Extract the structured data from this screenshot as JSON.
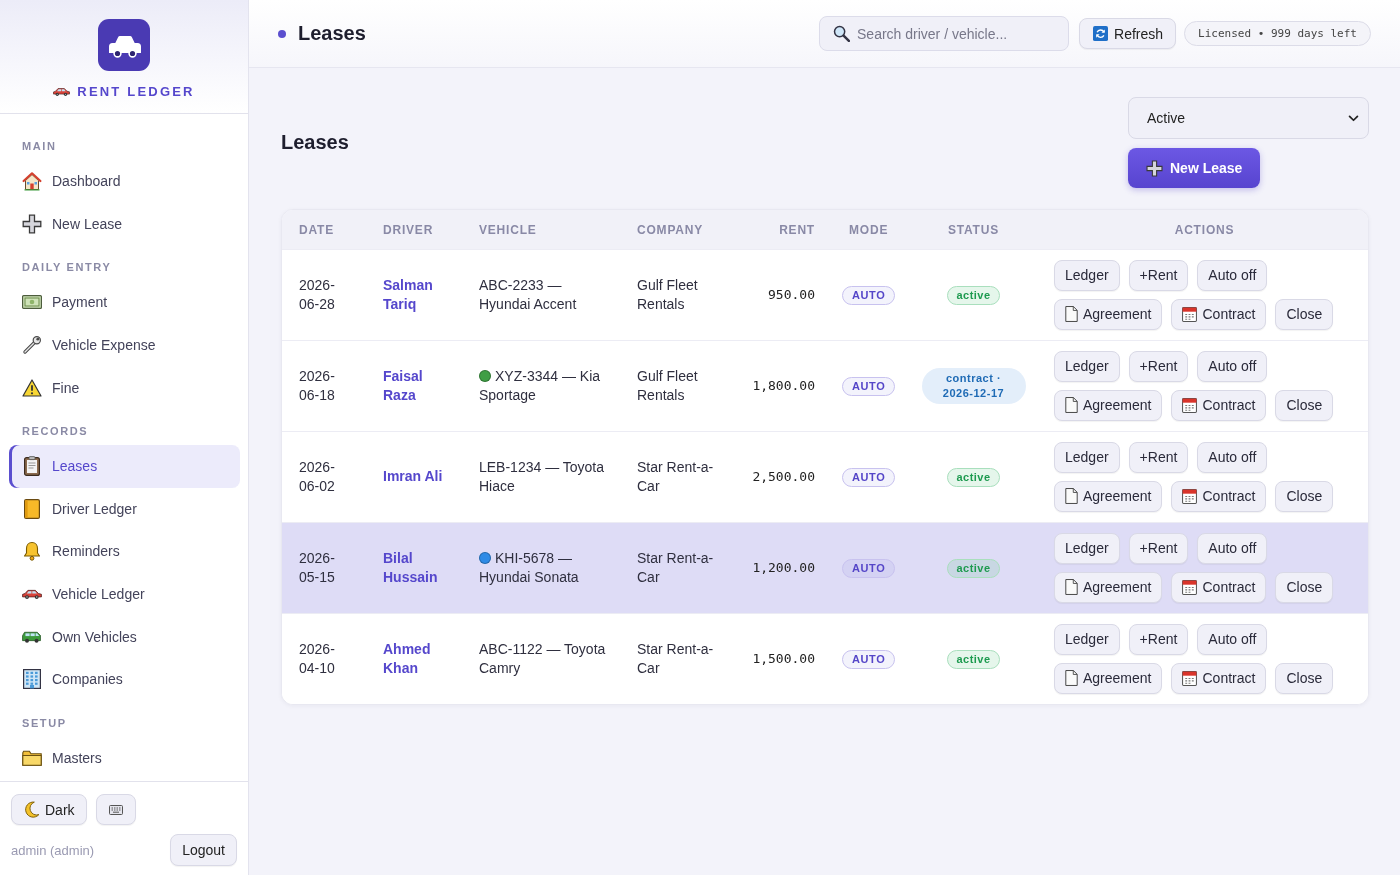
{
  "sidebar": {
    "brand": "RENT LEDGER",
    "sections": [
      {
        "label": "MAIN",
        "items": [
          {
            "label": "Dashboard",
            "selected": false
          },
          {
            "label": "New Lease",
            "selected": false
          }
        ]
      },
      {
        "label": "DAILY ENTRY",
        "items": [
          {
            "label": "Payment",
            "selected": false
          },
          {
            "label": "Vehicle Expense",
            "selected": false
          },
          {
            "label": "Fine",
            "selected": false
          }
        ]
      },
      {
        "label": "RECORDS",
        "items": [
          {
            "label": "Leases",
            "selected": true
          },
          {
            "label": "Driver Ledger",
            "selected": false
          },
          {
            "label": "Reminders",
            "selected": false
          },
          {
            "label": "Vehicle Ledger",
            "selected": false
          },
          {
            "label": "Own Vehicles",
            "selected": false
          },
          {
            "label": "Companies",
            "selected": false
          }
        ]
      },
      {
        "label": "SETUP",
        "items": [
          {
            "label": "Masters",
            "selected": false
          }
        ]
      }
    ],
    "theme_button": "Dark",
    "user": "admin (admin)",
    "logout": "Logout"
  },
  "topbar": {
    "title": "Leases",
    "search": {
      "placeholder": "Search driver / vehicle..."
    },
    "refresh": "Refresh",
    "license": "Licensed • 999 days left"
  },
  "page": {
    "heading": "Leases",
    "filter": {
      "value": "Active"
    },
    "new_button": "New Lease"
  },
  "table": {
    "columns": [
      "DATE",
      "DRIVER",
      "VEHICLE",
      "COMPANY",
      "RENT",
      "MODE",
      "STATUS",
      "ACTIONS"
    ],
    "rows": [
      {
        "selected": false,
        "date": "2026-06-28",
        "driver": "Salman Tariq",
        "vehicle": {
          "text": "ABC-2233 — Hyundai Accent"
        },
        "company": "Gulf Fleet Rentals",
        "rent": "950.00",
        "mode": "AUTO",
        "status": {
          "kind": "active",
          "label": "active"
        },
        "actions": [
          "Ledger",
          "+Rent",
          "Auto off",
          "Agreement",
          "Contract",
          "Close"
        ]
      },
      {
        "selected": false,
        "date": "2026-06-18",
        "driver": "Faisal Raza",
        "vehicle": {
          "text": "XYZ-3344 — Kia Sportage",
          "color": "#3f9e45"
        },
        "company": "Gulf Fleet Rentals",
        "rent": "1,800.00",
        "mode": "AUTO",
        "status": {
          "kind": "contract",
          "label": "contract · 2026-12-17"
        },
        "actions": [
          "Ledger",
          "+Rent",
          "Auto off",
          "Agreement",
          "Contract",
          "Close"
        ]
      },
      {
        "selected": false,
        "date": "2026-06-02",
        "driver": "Imran Ali",
        "vehicle": {
          "text": "LEB-1234 — Toyota Hiace"
        },
        "company": "Star Rent-a-Car",
        "rent": "2,500.00",
        "mode": "AUTO",
        "status": {
          "kind": "active",
          "label": "active"
        },
        "actions": [
          "Ledger",
          "+Rent",
          "Auto off",
          "Agreement",
          "Contract",
          "Close"
        ]
      },
      {
        "selected": true,
        "date": "2026-05-15",
        "driver": "Bilal Hussain",
        "vehicle": {
          "text": "KHI-5678 — Hyundai Sonata",
          "color": "#2f8be6"
        },
        "company": "Star Rent-a-Car",
        "rent": "1,200.00",
        "mode": "AUTO",
        "status": {
          "kind": "active",
          "label": "active"
        },
        "actions": [
          "Ledger",
          "+Rent",
          "Auto off",
          "Agreement",
          "Contract",
          "Close"
        ]
      },
      {
        "selected": false,
        "date": "2026-04-10",
        "driver": "Ahmed Khan",
        "vehicle": {
          "text": "ABC-1122 — Toyota Camry"
        },
        "company": "Star Rent-a-Car",
        "rent": "1,500.00",
        "mode": "AUTO",
        "status": {
          "kind": "active",
          "label": "active"
        },
        "actions": [
          "Ledger",
          "+Rent",
          "Auto off",
          "Agreement",
          "Contract",
          "Close"
        ]
      }
    ]
  }
}
